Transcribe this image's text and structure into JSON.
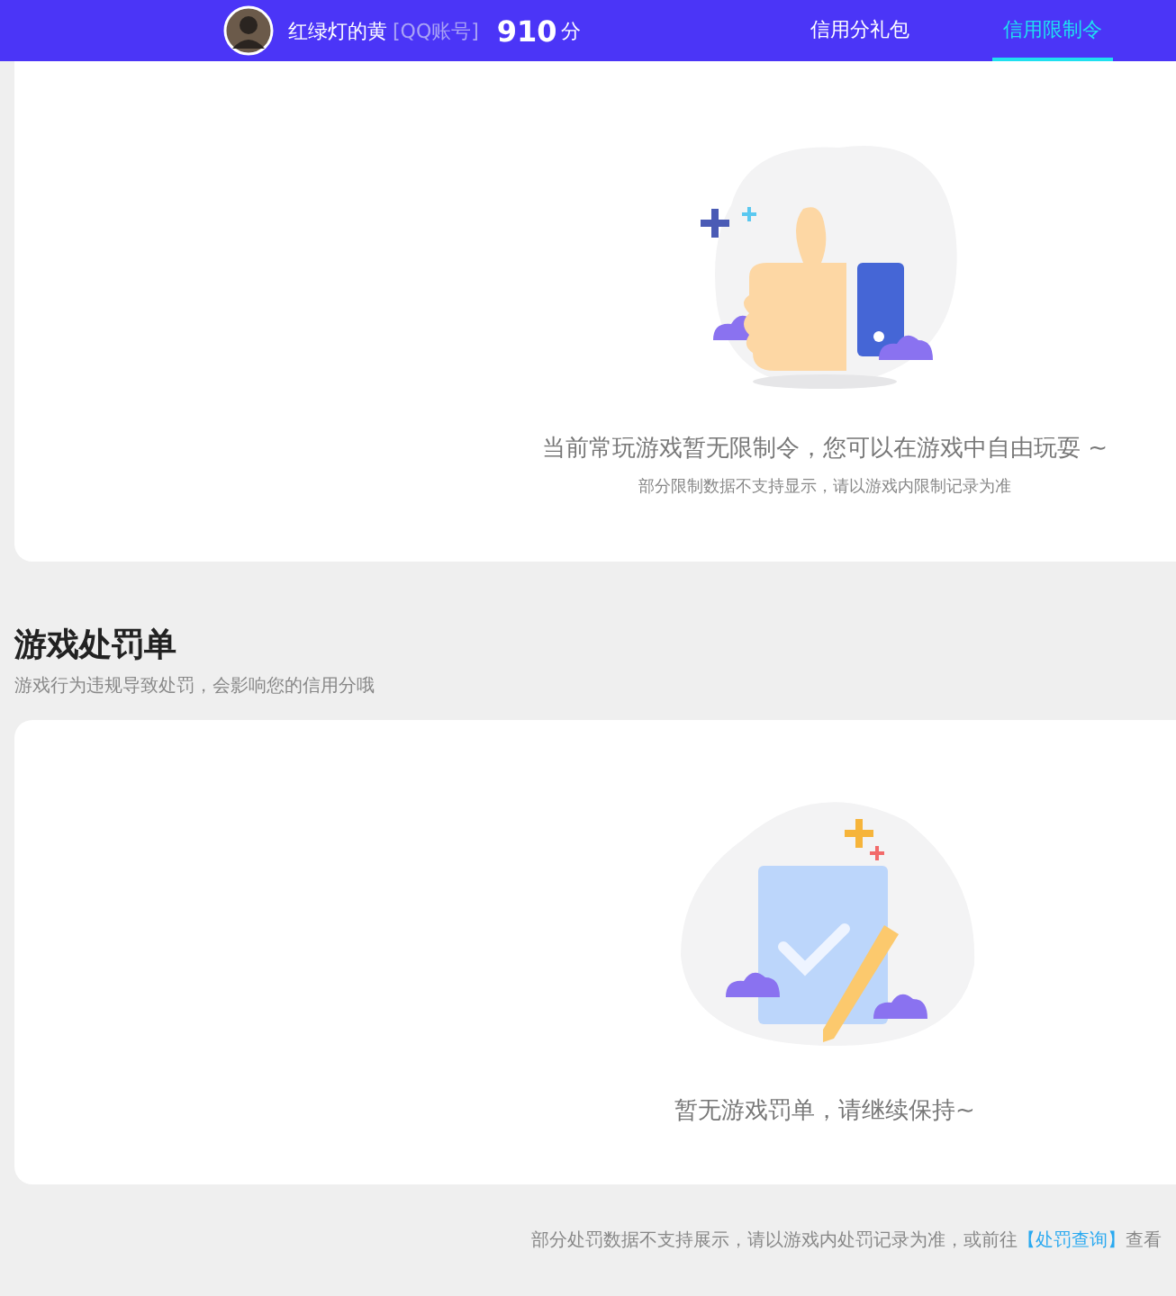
{
  "header": {
    "user_name": "红绿灯的黄",
    "account_tag": "[QQ账号]",
    "score": "910",
    "score_unit": "分",
    "tabs": [
      {
        "label": "信用分礼包",
        "selected": false
      },
      {
        "label": "信用限制令",
        "selected": true
      }
    ]
  },
  "restriction_card": {
    "message": "当前常玩游戏暂无限制令，您可以在游戏中自由玩耍 ~",
    "note": "部分限制数据不支持显示，请以游戏内限制记录为准"
  },
  "penalty_section": {
    "title": "游戏处罚单",
    "subtitle": "游戏行为违规导致处罚，会影响您的信用分哦",
    "message": "暂无游戏罚单，请继续保持~"
  },
  "footer": {
    "text": "部分处罚数据不支持展示，请以游戏内处罚记录为准，或前往",
    "link": "【处罚查询】",
    "suffix": "查看"
  }
}
